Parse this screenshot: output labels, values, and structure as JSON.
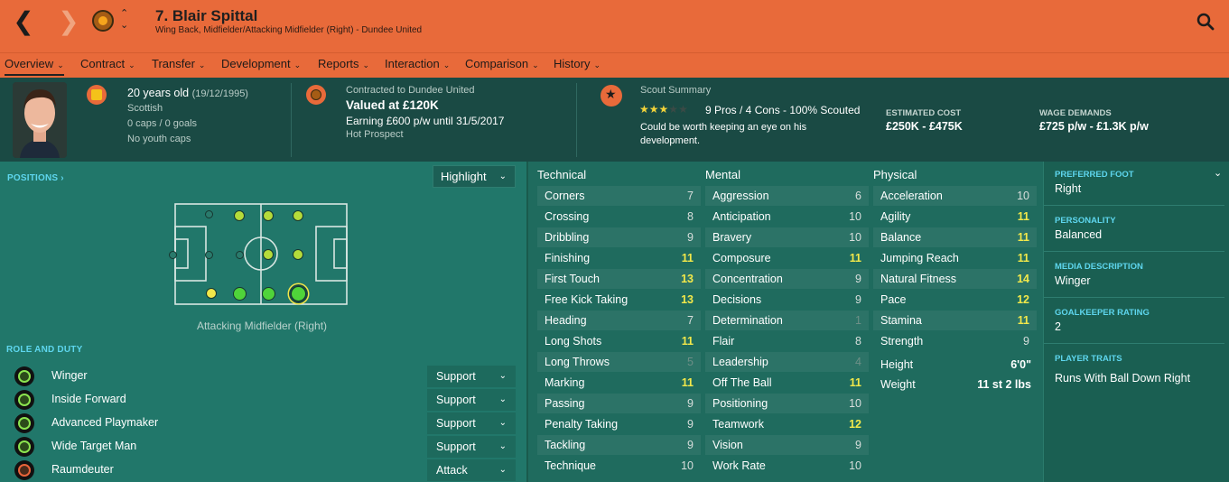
{
  "header": {
    "player_name": "7. Blair Spittal",
    "player_subtitle": "Wing Back, Midfielder/Attacking Midfielder (Right) - Dundee United"
  },
  "tabs": [
    {
      "label": "Overview"
    },
    {
      "label": "Contract"
    },
    {
      "label": "Transfer"
    },
    {
      "label": "Development"
    },
    {
      "label": "Reports"
    },
    {
      "label": "Interaction"
    },
    {
      "label": "Comparison"
    },
    {
      "label": "History"
    }
  ],
  "bio": {
    "age": "20 years old",
    "dob": "(19/12/1995)",
    "nationality": "Scottish",
    "caps": "0 caps / 0 goals",
    "youth_caps": "No youth caps"
  },
  "contract": {
    "contracted_to": "Contracted to Dundee United",
    "value": "Valued at £120K",
    "earning": "Earning £600 p/w until 31/5/2017",
    "status": "Hot Prospect"
  },
  "scout": {
    "title": "Scout Summary",
    "stars_filled": 3,
    "stars_total": 5,
    "summary": "9 Pros / 4 Cons - 100% Scouted",
    "note": "Could be worth keeping an eye on his development.",
    "estimated_cost_label": "ESTIMATED COST",
    "estimated_cost": "£250K - £475K",
    "wage_label": "WAGE DEMANDS",
    "wage": "£725 p/w - £1.3K p/w"
  },
  "positions": {
    "label": "POSITIONS",
    "highlight_label": "Highlight",
    "current_position": "Attacking Midfielder (Right)"
  },
  "role_section": {
    "label": "ROLE AND DUTY",
    "roles": [
      {
        "name": "Winger",
        "duty": "Support",
        "icon_color": "#8be44f"
      },
      {
        "name": "Inside Forward",
        "duty": "Support",
        "icon_color": "#8be44f"
      },
      {
        "name": "Advanced Playmaker",
        "duty": "Support",
        "icon_color": "#8be44f"
      },
      {
        "name": "Wide Target Man",
        "duty": "Support",
        "icon_color": "#8be44f"
      },
      {
        "name": "Raumdeuter",
        "duty": "Attack",
        "icon_color": "#e8643a"
      }
    ]
  },
  "attributes": {
    "technical_title": "Technical",
    "mental_title": "Mental",
    "physical_title": "Physical",
    "technical": [
      {
        "name": "Corners",
        "value": "7"
      },
      {
        "name": "Crossing",
        "value": "8"
      },
      {
        "name": "Dribbling",
        "value": "9"
      },
      {
        "name": "Finishing",
        "value": "11"
      },
      {
        "name": "First Touch",
        "value": "13"
      },
      {
        "name": "Free Kick Taking",
        "value": "13"
      },
      {
        "name": "Heading",
        "value": "7"
      },
      {
        "name": "Long Shots",
        "value": "11"
      },
      {
        "name": "Long Throws",
        "value": "5"
      },
      {
        "name": "Marking",
        "value": "11"
      },
      {
        "name": "Passing",
        "value": "9"
      },
      {
        "name": "Penalty Taking",
        "value": "9"
      },
      {
        "name": "Tackling",
        "value": "9"
      },
      {
        "name": "Technique",
        "value": "10"
      }
    ],
    "mental": [
      {
        "name": "Aggression",
        "value": "6"
      },
      {
        "name": "Anticipation",
        "value": "10"
      },
      {
        "name": "Bravery",
        "value": "10"
      },
      {
        "name": "Composure",
        "value": "11"
      },
      {
        "name": "Concentration",
        "value": "9"
      },
      {
        "name": "Decisions",
        "value": "9"
      },
      {
        "name": "Determination",
        "value": "1"
      },
      {
        "name": "Flair",
        "value": "8"
      },
      {
        "name": "Leadership",
        "value": "4"
      },
      {
        "name": "Off The Ball",
        "value": "11"
      },
      {
        "name": "Positioning",
        "value": "10"
      },
      {
        "name": "Teamwork",
        "value": "12"
      },
      {
        "name": "Vision",
        "value": "9"
      },
      {
        "name": "Work Rate",
        "value": "10"
      }
    ],
    "physical": [
      {
        "name": "Acceleration",
        "value": "10"
      },
      {
        "name": "Agility",
        "value": "11"
      },
      {
        "name": "Balance",
        "value": "11"
      },
      {
        "name": "Jumping Reach",
        "value": "11"
      },
      {
        "name": "Natural Fitness",
        "value": "14"
      },
      {
        "name": "Pace",
        "value": "12"
      },
      {
        "name": "Stamina",
        "value": "11"
      },
      {
        "name": "Strength",
        "value": "9"
      }
    ],
    "height_label": "Height",
    "height": "6'0\"",
    "weight_label": "Weight",
    "weight": "11 st 2 lbs"
  },
  "side": {
    "preferred_foot_label": "PREFERRED FOOT",
    "preferred_foot": "Right",
    "personality_label": "PERSONALITY",
    "personality": "Balanced",
    "media_label": "MEDIA DESCRIPTION",
    "media": "Winger",
    "gk_label": "GOALKEEPER RATING",
    "gk": "2",
    "traits_label": "PLAYER TRAITS",
    "traits": "Runs With Ball Down Right"
  },
  "colors": {
    "header_orange": "#e86a3a",
    "accent_cyan": "#5ed6ee",
    "highlight_yellow": "#f2e84a"
  }
}
